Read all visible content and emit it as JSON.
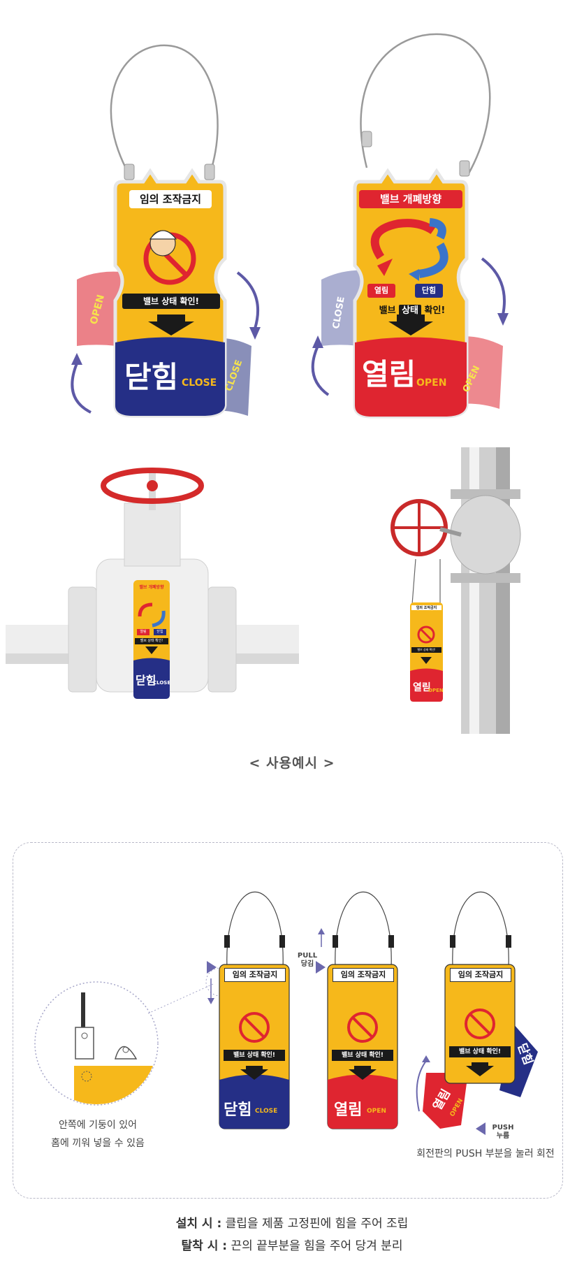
{
  "tag_closed": {
    "title": "임의 조작금지",
    "check": "밸브 상태 확인!",
    "big": "닫힘",
    "small": "CLOSE",
    "side_label": "CLOSE",
    "flip_label": "OPEN"
  },
  "tag_open": {
    "title": "밸브 개폐방향",
    "btn_open": "열림",
    "btn_close": "단힘",
    "check_pre": "밸브",
    "check_mid": "상태",
    "check_post": "확인!",
    "big": "열림",
    "small": "OPEN",
    "side_label": "OPEN",
    "flip_label": "CLOSE"
  },
  "usage_tag_a": {
    "title": "밸브 개폐방향",
    "btn_open": "열림",
    "btn_close": "닫힘",
    "check": "밸브 상태 확인!",
    "big": "닫힘",
    "small": "CLOSE"
  },
  "usage_tag_b": {
    "title": "임의 조작금지",
    "check": "밸브 상태 확인!",
    "big": "열림",
    "small": "OPEN"
  },
  "usage_caption": "< 사용예시 >",
  "howto": {
    "pull_label": "PULL",
    "pull_sub": "당김",
    "push_label": "PUSH",
    "push_sub": "누름",
    "note_left_1": "안쪽에 기둥이 있어",
    "note_left_2": "홈에 끼워 넣을 수 있음",
    "note_right": "회전판의 PUSH 부분을 눌러 회전",
    "tag1": {
      "title": "임의 조작금지",
      "check": "밸브 상태 확인!",
      "big": "닫힘",
      "small": "CLOSE"
    },
    "tag2": {
      "title": "임의 조작금지",
      "check": "밸브 상태 확인!",
      "big": "열림",
      "small": "OPEN"
    },
    "tag3": {
      "title": "임의 조작금지",
      "check": "밸브 상태 확인!",
      "big_a": "열림",
      "small_a": "OPEN",
      "big_b": "닫힘"
    }
  },
  "install": {
    "label": "설치 시 :",
    "text": " 클립을 제품 고정핀에 힘을 주어 조립"
  },
  "remove": {
    "label": "탈착 시 :",
    "text": " 끈의 끝부분을 힘을 주어 당겨 분리"
  },
  "colors": {
    "yellow": "#f6b81b",
    "navy": "#252f86",
    "red": "#df2530",
    "arrow": "#5d59a6"
  }
}
